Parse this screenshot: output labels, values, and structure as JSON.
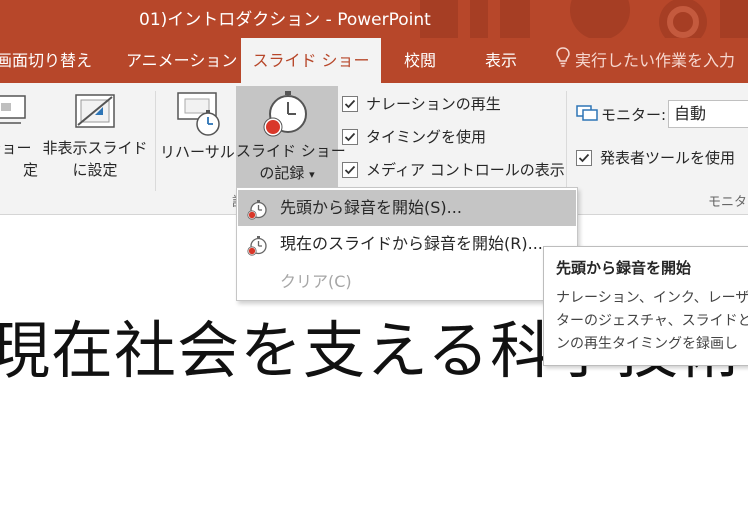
{
  "window": {
    "title": "01)イントロダクション - PowerPoint"
  },
  "tabs": [
    {
      "label": "画面切り替え",
      "active": false
    },
    {
      "label": "アニメーション",
      "active": false
    },
    {
      "label": "スライド ショー",
      "active": true
    },
    {
      "label": "校閲",
      "active": false
    },
    {
      "label": "表示",
      "active": false
    }
  ],
  "tell_me": {
    "label": "実行したい作業を入力"
  },
  "ribbon": {
    "setup_button": {
      "line1": "ショー",
      "line2": "定"
    },
    "hide_slide_button": {
      "line1": "非表示スライド",
      "line2": "に設定"
    },
    "rehearse_button": {
      "label": "リハーサル"
    },
    "record_button": {
      "line1": "スライド ショー",
      "line2": "の記録",
      "arrow": "▾"
    },
    "checkboxes": [
      {
        "label": "ナレーションの再生",
        "checked": true
      },
      {
        "label": "タイミングを使用",
        "checked": true
      },
      {
        "label": "メディア コントロールの表示",
        "checked": true
      }
    ],
    "monitor": {
      "label": "モニター:",
      "value": "自動"
    },
    "presenter_view": {
      "label": "発表者ツールを使用",
      "checked": true
    },
    "group_labels": {
      "setup_group_partial": "設",
      "monitors_group_partial": "モニタ"
    }
  },
  "record_menu": {
    "items": [
      {
        "label": "先頭から録音を開始(S)...",
        "mnemonic": "S",
        "enabled": true,
        "highlighted": true
      },
      {
        "label": "現在のスライドから録音を開始(R)...",
        "mnemonic": "R",
        "enabled": true,
        "highlighted": false
      },
      {
        "label": "クリア(C)",
        "mnemonic": "C",
        "enabled": false,
        "highlighted": false
      }
    ]
  },
  "tooltip": {
    "title": "先頭から録音を開始",
    "lines": [
      "ナレーション、インク、レーザー",
      "ターのジェスチャ、スライドとア",
      "ンの再生タイミングを録画し"
    ]
  },
  "slide": {
    "title_text": "現在社会を支える科学技術"
  },
  "colors": {
    "accent": "#b7472a",
    "ribbon_bg": "#f3f3f3",
    "pressed": "#c5c5c5"
  },
  "icons": {
    "setup": "slideshow-setup-icon",
    "hide": "hide-slide-icon",
    "rehearse": "rehearse-timings-icon",
    "record": "record-slideshow-icon",
    "menu_item": "record-stopwatch-icon",
    "tell_me": "lightbulb-icon",
    "monitor": "monitor-icon"
  }
}
